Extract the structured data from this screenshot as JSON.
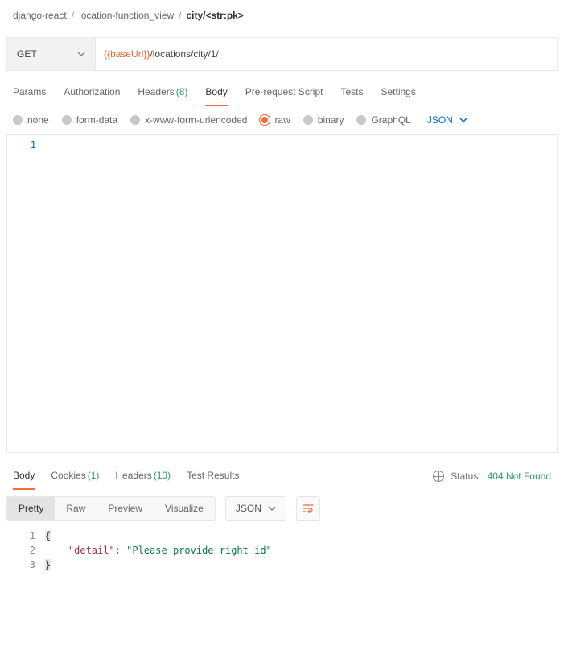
{
  "breadcrumb": {
    "items": [
      "django-react",
      "location-function_view",
      "city/<str:pk>"
    ]
  },
  "request": {
    "method": "GET",
    "url_var": "{{baseUrl}}",
    "url_path": "/locations/city/1/"
  },
  "tabs": {
    "params": "Params",
    "authorization": "Authorization",
    "headers": "Headers",
    "headers_count": "(8)",
    "body": "Body",
    "prerequest": "Pre-request Script",
    "tests": "Tests",
    "settings": "Settings"
  },
  "body_types": {
    "none": "none",
    "formdata": "form-data",
    "xwww": "x-www-form-urlencoded",
    "raw": "raw",
    "binary": "binary",
    "graphql": "GraphQL",
    "lang": "JSON"
  },
  "editor": {
    "line1_num": "1"
  },
  "response": {
    "tabs": {
      "body": "Body",
      "cookies": "Cookies",
      "cookies_count": "(1)",
      "headers": "Headers",
      "headers_count": "(10)",
      "tests": "Test Results"
    },
    "status_label": "Status:",
    "status_code": "404 Not Found",
    "views": {
      "pretty": "Pretty",
      "raw": "Raw",
      "preview": "Preview",
      "visualize": "Visualize"
    },
    "lang": "JSON",
    "json_lines": {
      "l1_num": "1",
      "l2_num": "2",
      "l3_num": "3",
      "l1_open": "{",
      "l2_key": "\"detail\"",
      "l2_colon": ": ",
      "l2_val": "\"Please provide right id\"",
      "l3_close": "}"
    }
  }
}
